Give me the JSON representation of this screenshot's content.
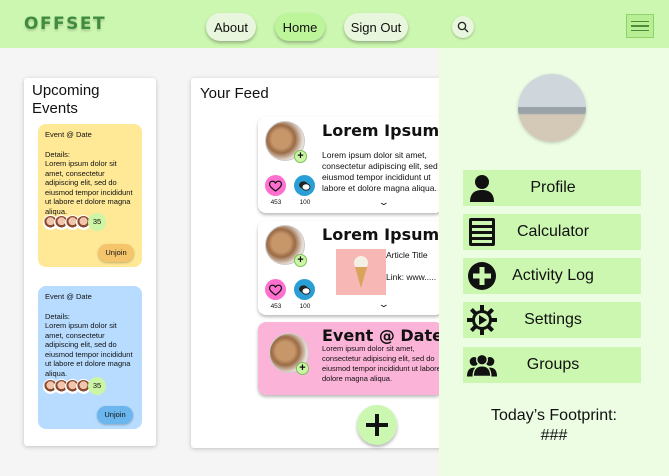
{
  "brand": "OFFSET",
  "nav": {
    "about": "About",
    "home": "Home",
    "signout": "Sign Out"
  },
  "icons": {
    "search": "search-icon",
    "menu": "hamburger-menu-icon"
  },
  "upcoming": {
    "title": "Upcoming Events",
    "events": [
      {
        "title": "Event @ Date",
        "details_label": "Details:",
        "details": "Lorem ipsum dolor sit amet, consectetur adipiscing elit, sed do eiusmod tempor incididunt ut labore et dolore magna aliqua.",
        "count": "35",
        "button": "Unjoin",
        "color": "#ffe896"
      },
      {
        "title": "Event @ Date",
        "details_label": "Details:",
        "details": "Lorem ipsum dolor sit amet, consectetur adipiscing elit, sed do eiusmod tempor incididunt ut labore et dolore magna aliqua.",
        "count": "35",
        "button": "Unjoin",
        "color": "#b7dcff"
      }
    ]
  },
  "feed": {
    "title": "Your Feed",
    "posts": [
      {
        "title": "Lorem Ipsum",
        "text": "Lorem ipsum dolor sit amet, consectetur adipiscing elit, sed do eiusmod tempor incididunt ut labore et dolore magna aliqua.",
        "likes": "453",
        "comments": "100"
      },
      {
        "title": "Lorem Ipsum",
        "article_title": "Article Title",
        "link": "Link: www.....",
        "likes": "453",
        "comments": "100"
      },
      {
        "title": "Event @ Date",
        "text": "Lorem ipsum dolor sit amet, consectetur adipiscing elit, sed do eiusmod tempor incididunt ut labore et dolore magna aliqua.",
        "color": "#fbb3d8"
      }
    ]
  },
  "menu": {
    "items": [
      {
        "label": "Profile",
        "icon": "person-icon"
      },
      {
        "label": "Calculator",
        "icon": "calculator-icon"
      },
      {
        "label": "Activity Log",
        "icon": "plus-circle-icon"
      },
      {
        "label": "Settings",
        "icon": "gear-icon"
      },
      {
        "label": "Groups",
        "icon": "group-icon"
      }
    ],
    "footprint_label": "Today’s Footprint:",
    "footprint_value": "###"
  },
  "colors": {
    "accent": "#ccf7b0",
    "drawer": "#ecfde4",
    "pink_like": "#ff6fd0",
    "blue_comment": "#2a9fd6"
  }
}
